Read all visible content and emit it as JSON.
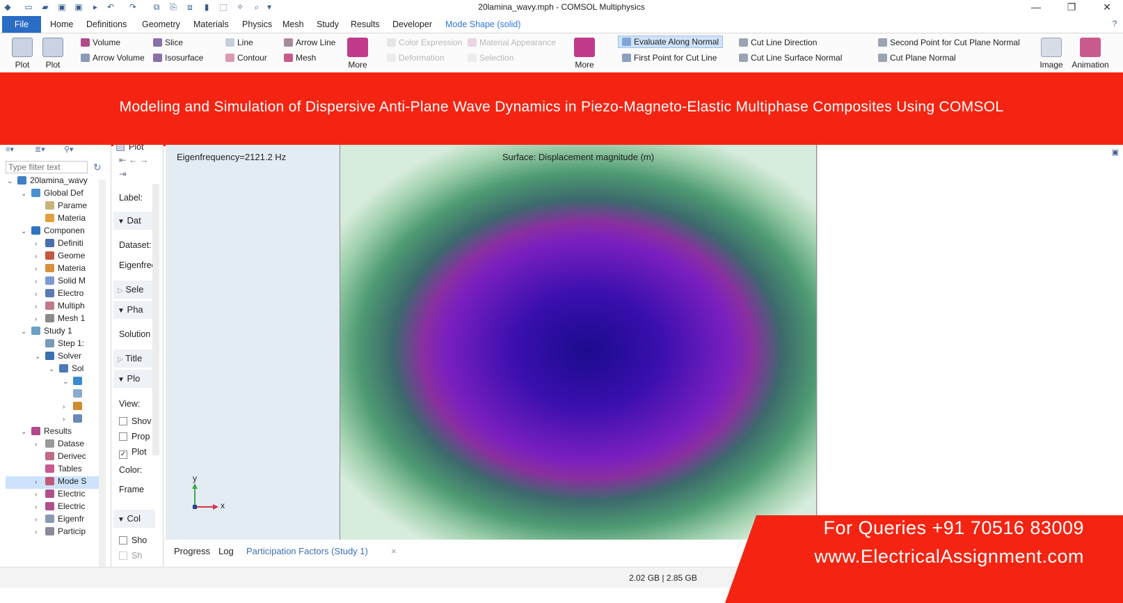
{
  "window": {
    "title": "20lamina_wavy.mph - COMSOL Multiphysics"
  },
  "menu_tabs": [
    "File",
    "Home",
    "Definitions",
    "Geometry",
    "Materials",
    "Physics",
    "Mesh",
    "Study",
    "Results",
    "Developer",
    "Mode Shape (solid)"
  ],
  "ribbon": {
    "plot1": "Plot",
    "plot2": "Plot",
    "volume": "Volume",
    "arrow_volume": "Arrow Volume",
    "slice": "Slice",
    "isosurface": "Isosurface",
    "line": "Line",
    "contour": "Contour",
    "arrow_line": "Arrow Line",
    "mesh": "Mesh",
    "more1": "More",
    "color_expression": "Color Expression",
    "deformation": "Deformation",
    "material_appearance": "Material Appearance",
    "selection": "Selection",
    "more2": "More",
    "evaluate_along_normal": "Evaluate Along Normal",
    "first_point_cut_line": "First Point for Cut Line",
    "cut_line_direction": "Cut Line Direction",
    "cut_line_surface_normal": "Cut Line Surface Normal",
    "second_point_cut_plane": "Second Point for Cut Plane Normal",
    "cut_plane_normal": "Cut Plane Normal",
    "image": "Image",
    "animation": "Animation"
  },
  "banner": {
    "text": "Modeling and Simulation of Dispersive Anti-Plane Wave Dynamics in Piezo-Magneto-Elastic Multiphase Composites Using COMSOL"
  },
  "tree": {
    "filter_placeholder": "Type filter text",
    "nodes": [
      {
        "label": "20lamina_wavy",
        "arrow": "⌄",
        "indent": 0
      },
      {
        "label": "Global Def",
        "arrow": "⌄",
        "indent": 1
      },
      {
        "label": "Parame",
        "arrow": "",
        "indent": 2
      },
      {
        "label": "Materia",
        "arrow": "",
        "indent": 2
      },
      {
        "label": "Componen",
        "arrow": "⌄",
        "indent": 1
      },
      {
        "label": "Definiti",
        "arrow": "›",
        "indent": 2
      },
      {
        "label": "Geome",
        "arrow": "›",
        "indent": 2
      },
      {
        "label": "Materia",
        "arrow": "›",
        "indent": 2
      },
      {
        "label": "Solid M",
        "arrow": "›",
        "indent": 2
      },
      {
        "label": "Electro",
        "arrow": "›",
        "indent": 2
      },
      {
        "label": "Multiph",
        "arrow": "›",
        "indent": 2
      },
      {
        "label": "Mesh 1",
        "arrow": "›",
        "indent": 2
      },
      {
        "label": "Study 1",
        "arrow": "⌄",
        "indent": 1
      },
      {
        "label": "Step 1:",
        "arrow": "",
        "indent": 2
      },
      {
        "label": "Solver",
        "arrow": "⌄",
        "indent": 2
      },
      {
        "label": "Sol",
        "arrow": "⌄",
        "indent": 3
      },
      {
        "label": "",
        "arrow": "⌄",
        "indent": 4
      },
      {
        "label": "",
        "arrow": "",
        "indent": 4
      },
      {
        "label": "",
        "arrow": "›",
        "indent": 4
      },
      {
        "label": "",
        "arrow": "›",
        "indent": 4
      },
      {
        "label": "Results",
        "arrow": "⌄",
        "indent": 1
      },
      {
        "label": "Datase",
        "arrow": "›",
        "indent": 2
      },
      {
        "label": "Derivec",
        "arrow": "",
        "indent": 2
      },
      {
        "label": "Tables",
        "arrow": "",
        "indent": 2
      },
      {
        "label": "Mode S",
        "arrow": "›",
        "indent": 2
      },
      {
        "label": "Electric",
        "arrow": "›",
        "indent": 2
      },
      {
        "label": "Electric",
        "arrow": "›",
        "indent": 2
      },
      {
        "label": "Eigenfr",
        "arrow": "›",
        "indent": 2
      },
      {
        "label": "Particip",
        "arrow": "›",
        "indent": 2
      }
    ]
  },
  "settings": {
    "plot_label": "Plot",
    "label_field": "Label:",
    "data_section": "Dat",
    "dataset": "Dataset:",
    "eigenfreq": "Eigenfrec",
    "selection_section": "Sele",
    "phase_section": "Pha",
    "solution": "Solution",
    "title_section": "Title",
    "plot_settings_section": "Plo",
    "view": "View:",
    "show": "Shov",
    "prop": "Prop",
    "plot_check": "Plot",
    "color": "Color:",
    "frame": "Frame",
    "col_section": "Col",
    "sho": "Sho",
    "sh": "Sh"
  },
  "graphics": {
    "eigenfrequency": "Eigenfrequency=2121.2 Hz",
    "plot_title": "Surface: Displacement magnitude (m)",
    "axis_x": "x",
    "axis_y": "y"
  },
  "bottom_tabs": [
    "Progress",
    "Log",
    "Participation Factors (Study 1)"
  ],
  "status": {
    "memory": "2.02 GB | 2.85 GB"
  },
  "promo": {
    "phone": "For Queries +91 70516 83009",
    "website": "www.ElectricalAssignment.com"
  },
  "colors": {
    "accent": "#2b6cc4",
    "banner": "#f52412",
    "selected": "#cde3fb"
  }
}
